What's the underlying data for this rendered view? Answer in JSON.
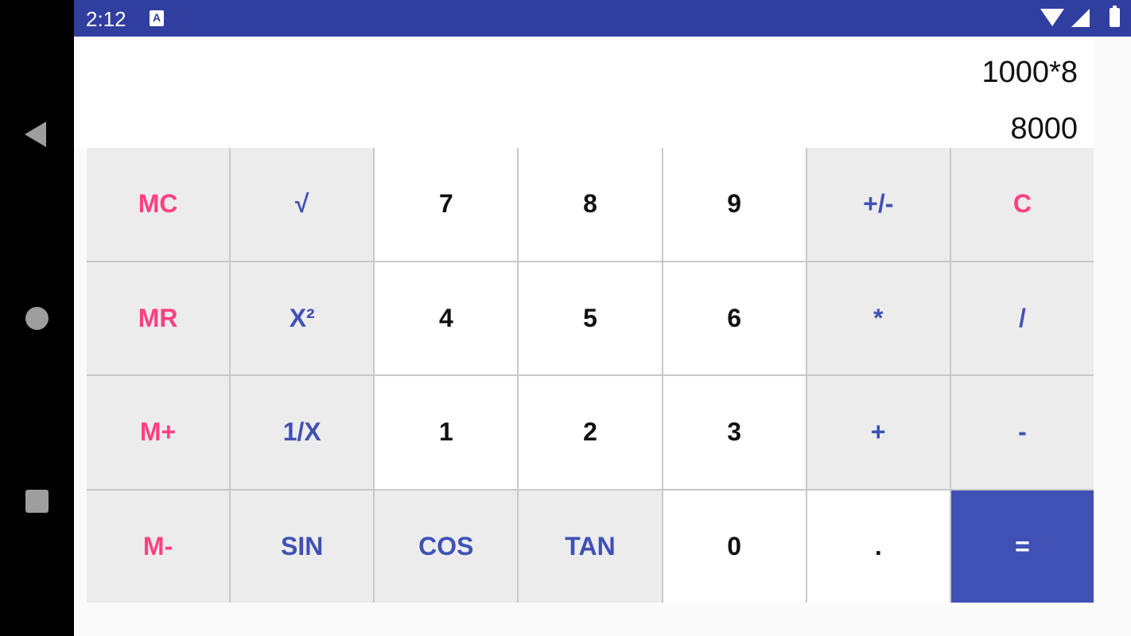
{
  "status_bar": {
    "time": "2:12",
    "notification_icon_letter": "A",
    "icons": [
      "wifi-icon",
      "signal-icon",
      "battery-icon"
    ]
  },
  "navigation": {
    "icons": [
      "back-icon",
      "home-icon",
      "recents-icon"
    ]
  },
  "display": {
    "expression": "1000*8",
    "result": "8000"
  },
  "colors": {
    "status_bar": "#303f9f",
    "memory_key_text": "#ff4081",
    "function_key_text": "#3f51b5",
    "equals_key_bg": "#3f51b5",
    "gray_key_bg": "#ececec",
    "white_key_bg": "#ffffff"
  },
  "keypad": {
    "rows": [
      [
        {
          "label": "MC",
          "style": "gray",
          "color": "pink",
          "name": "memory-clear-button"
        },
        {
          "label": "√",
          "style": "gray",
          "color": "blue",
          "name": "square-root-button"
        },
        {
          "label": "7",
          "style": "white",
          "color": "black",
          "name": "digit-7-button"
        },
        {
          "label": "8",
          "style": "white",
          "color": "black",
          "name": "digit-8-button"
        },
        {
          "label": "9",
          "style": "white",
          "color": "black",
          "name": "digit-9-button"
        },
        {
          "label": "+/-",
          "style": "gray",
          "color": "blue",
          "name": "sign-toggle-button"
        },
        {
          "label": "C",
          "style": "gray",
          "color": "pink",
          "name": "clear-button"
        }
      ],
      [
        {
          "label": "MR",
          "style": "gray",
          "color": "pink",
          "name": "memory-recall-button"
        },
        {
          "label": "X²",
          "style": "gray",
          "color": "blue",
          "name": "square-button"
        },
        {
          "label": "4",
          "style": "white",
          "color": "black",
          "name": "digit-4-button"
        },
        {
          "label": "5",
          "style": "white",
          "color": "black",
          "name": "digit-5-button"
        },
        {
          "label": "6",
          "style": "white",
          "color": "black",
          "name": "digit-6-button"
        },
        {
          "label": "*",
          "style": "gray",
          "color": "blue",
          "name": "multiply-button"
        },
        {
          "label": "/",
          "style": "gray",
          "color": "blue",
          "name": "divide-button"
        }
      ],
      [
        {
          "label": "M+",
          "style": "gray",
          "color": "pink",
          "name": "memory-add-button"
        },
        {
          "label": "1/X",
          "style": "gray",
          "color": "blue",
          "name": "reciprocal-button"
        },
        {
          "label": "1",
          "style": "white",
          "color": "black",
          "name": "digit-1-button"
        },
        {
          "label": "2",
          "style": "white",
          "color": "black",
          "name": "digit-2-button"
        },
        {
          "label": "3",
          "style": "white",
          "color": "black",
          "name": "digit-3-button"
        },
        {
          "label": "+",
          "style": "gray",
          "color": "blue",
          "name": "add-button"
        },
        {
          "label": "-",
          "style": "gray",
          "color": "blue",
          "name": "subtract-button"
        }
      ],
      [
        {
          "label": "M-",
          "style": "gray",
          "color": "pink",
          "name": "memory-subtract-button"
        },
        {
          "label": "SIN",
          "style": "gray",
          "color": "blue",
          "name": "sin-button"
        },
        {
          "label": "COS",
          "style": "gray",
          "color": "blue",
          "name": "cos-button"
        },
        {
          "label": "TAN",
          "style": "gray",
          "color": "blue",
          "name": "tan-button"
        },
        {
          "label": "0",
          "style": "white",
          "color": "black",
          "name": "digit-0-button"
        },
        {
          "label": ".",
          "style": "white",
          "color": "black",
          "name": "decimal-point-button"
        },
        {
          "label": "=",
          "style": "eq",
          "color": "white",
          "name": "equals-button"
        }
      ]
    ]
  }
}
